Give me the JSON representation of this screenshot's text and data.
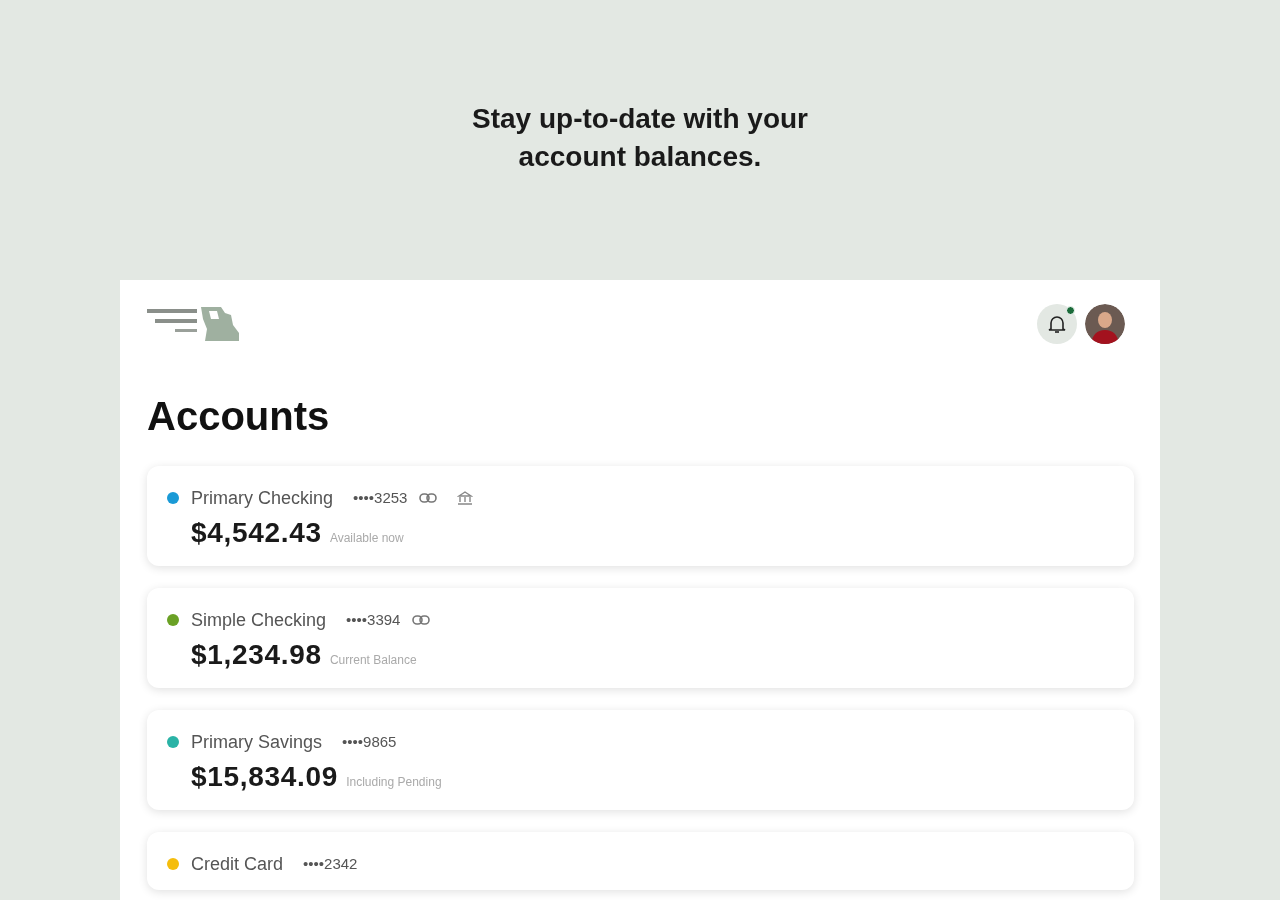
{
  "headline": "Stay up-to-date with your account balances.",
  "header": {
    "notifications": {
      "unread": true
    }
  },
  "title": "Accounts",
  "accounts": [
    {
      "name": "Primary Checking",
      "number": "••••3253",
      "linked": true,
      "bank": true,
      "color": "#1a9ad6",
      "balance": "$4,542.43",
      "balance_label": "Available now"
    },
    {
      "name": "Simple Checking",
      "number": "••••3394",
      "linked": true,
      "bank": false,
      "color": "#6aa125",
      "balance": "$1,234.98",
      "balance_label": "Current Balance"
    },
    {
      "name": "Primary Savings",
      "number": "••••9865",
      "linked": false,
      "bank": false,
      "color": "#2ab3a6",
      "balance": "$15,834.09",
      "balance_label": "Including Pending"
    },
    {
      "name": "Credit Card",
      "number": "••••2342",
      "linked": false,
      "bank": false,
      "color": "#f5bd0c"
    }
  ]
}
